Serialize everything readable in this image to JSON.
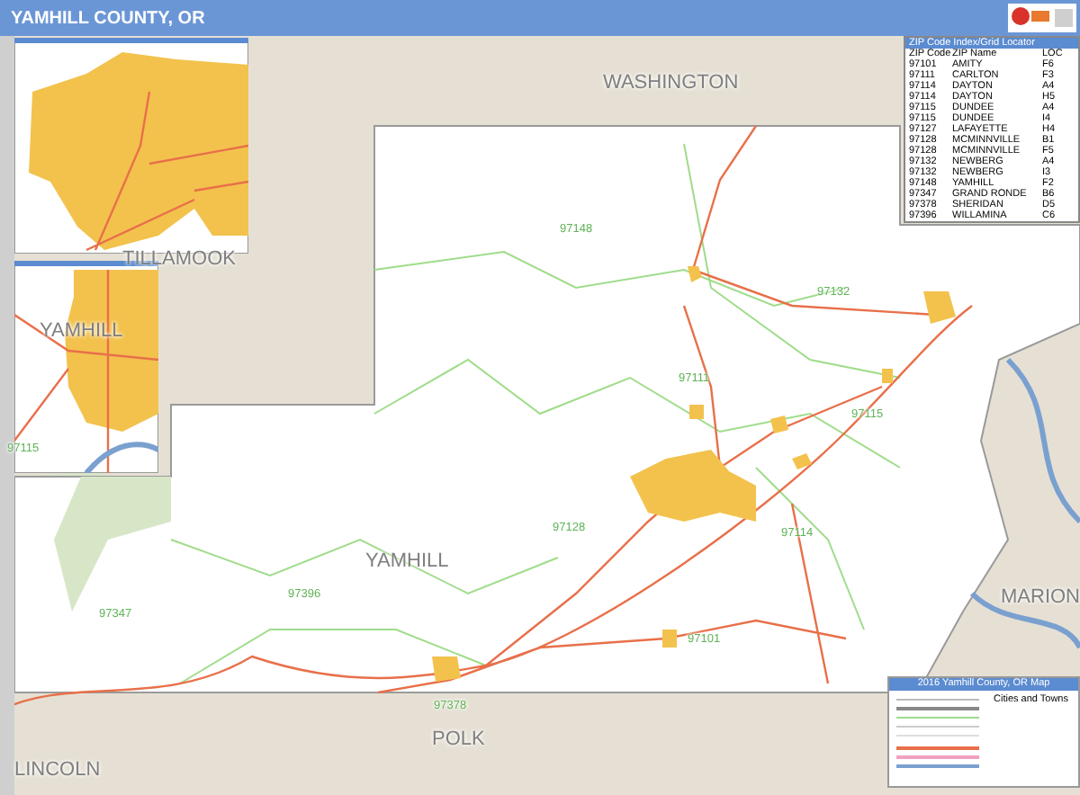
{
  "title": "YAMHILL COUNTY, OR",
  "county_labels": [
    {
      "text": "WASHINGTON"
    },
    {
      "text": "TILLAMOOK"
    },
    {
      "text": "YAMHILL"
    },
    {
      "text": "YAMHILL"
    },
    {
      "text": "MARION"
    },
    {
      "text": "POLK"
    },
    {
      "text": "LINCOLN"
    }
  ],
  "zip_labels": [
    "97148",
    "97132",
    "97111",
    "97115",
    "97128",
    "97114",
    "97101",
    "97396",
    "97347",
    "97378",
    "97115"
  ],
  "zip_index": {
    "title": "ZIP Code Index/Grid Locator",
    "columns": [
      "ZIP Code",
      "ZIP Name",
      "LOC"
    ],
    "rows": [
      [
        "97101",
        "AMITY",
        "F6"
      ],
      [
        "97111",
        "CARLTON",
        "F3"
      ],
      [
        "97114",
        "DAYTON",
        "A4"
      ],
      [
        "97114",
        "DAYTON",
        "H5"
      ],
      [
        "97115",
        "DUNDEE",
        "A4"
      ],
      [
        "97115",
        "DUNDEE",
        "I4"
      ],
      [
        "97127",
        "LAFAYETTE",
        "H4"
      ],
      [
        "97128",
        "MCMINNVILLE",
        "B1"
      ],
      [
        "97128",
        "MCMINNVILLE",
        "F5"
      ],
      [
        "97132",
        "NEWBERG",
        "A4"
      ],
      [
        "97132",
        "NEWBERG",
        "I3"
      ],
      [
        "97148",
        "YAMHILL",
        "F2"
      ],
      [
        "97347",
        "GRAND RONDE",
        "B6"
      ],
      [
        "97378",
        "SHERIDAN",
        "D5"
      ],
      [
        "97396",
        "WILLAMINA",
        "C6"
      ]
    ]
  },
  "legend": {
    "title": "2016 Yamhill County, OR Map",
    "subtitle": "Cities and Towns"
  }
}
